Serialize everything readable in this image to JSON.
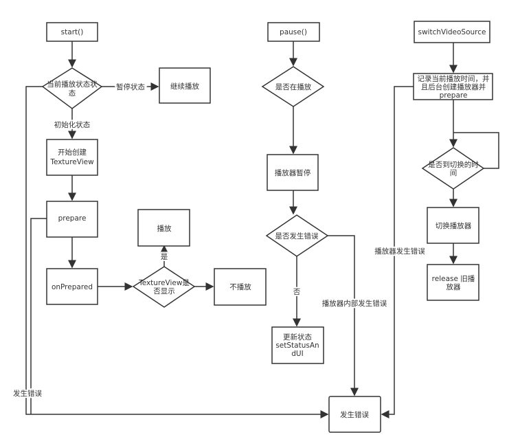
{
  "nodes": {
    "start": "start()",
    "state_check": [
      "当前播放状态状",
      "态"
    ],
    "resume": "继续播放",
    "create_tv": [
      "开始创建",
      "TextureView"
    ],
    "prepare": "prepare",
    "on_prepared": "onPrepared",
    "tv_shown": [
      "TextureView是",
      "否显示"
    ],
    "play": "播放",
    "no_play": "不播放",
    "pause": "pause()",
    "is_playing": "是否在播放",
    "player_pause": "播放器暂停",
    "error_check": "是否发生错误",
    "update_status": [
      "更新状态",
      "setStatusAn",
      "dUI"
    ],
    "error": "发生错误",
    "switch": "switchVideoSource",
    "record": [
      "记录当前播放时间，并",
      "且后台创建播放器并",
      "prepare"
    ],
    "switch_time": [
      "是否到切换的时",
      "间"
    ],
    "switch_player": "切换播放器",
    "release": [
      "release 旧播",
      "放器"
    ]
  },
  "edges": {
    "paused_state": "暂停状态",
    "init_state": "初始化状态",
    "yes": "是",
    "no": "否",
    "internal_error": "播放器内部发生错误",
    "player_error": "播放器发生错误",
    "error_occurred": "发生错误"
  }
}
